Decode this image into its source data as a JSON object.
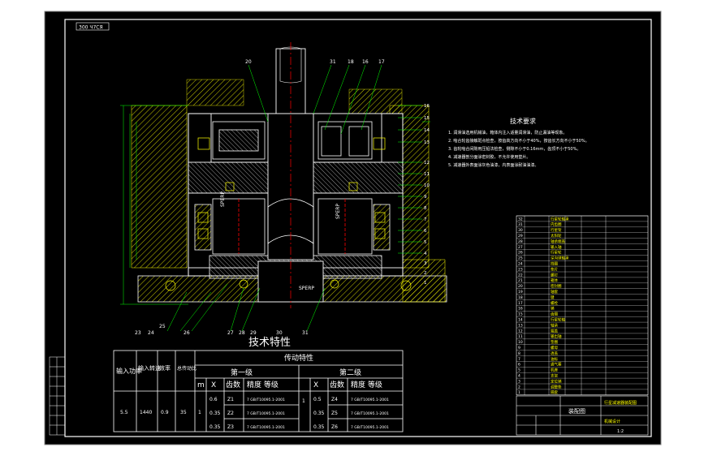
{
  "drawing": {
    "view_label": "300 Ч7СЯ",
    "tech_req_title": "技术要求",
    "tech_req": [
      "1. 润滑油选用机械油，箱体内注入适量润滑油，防止漏油等现象。",
      "2. 啮合轮齿接触斑点检查，按齿高方向不小于40%，按齿长方向不小于50%。",
      "3. 齿轮啮合间隙用压铅法检查，侧隙不小于0.16mm，齿顶不小于50%。",
      "4. 减速器剖分面涂密封胶，不允许使用垫片。",
      "5. 减速器外表面涂灰色油漆，内表面涂耐油油漆。"
    ],
    "callouts_top": [
      "20",
      "31",
      "18",
      "16",
      "17"
    ],
    "callouts_right": [
      "16",
      "15",
      "14",
      "13",
      "12",
      "11",
      "10",
      "9",
      "8",
      "7",
      "6",
      "5",
      "4",
      "3",
      "2",
      "1"
    ],
    "callouts_bottom": [
      "23",
      "24",
      "25",
      "26",
      "27",
      "28",
      "29",
      "30",
      "31"
    ],
    "shaft_labels": [
      "SPERP",
      "SPERP",
      "SPERP"
    ],
    "title_block": {
      "name": "行星减速器装配图",
      "school": "机械设计",
      "scale": "1:2"
    }
  },
  "spec_table": {
    "title": "技术特性",
    "headers": {
      "input_power": "输入功率",
      "input_speed": "输入转速",
      "efficiency": "效率",
      "total_ratio": "总传动比",
      "transmission": "传动特性",
      "stage1": "第一级",
      "stage2": "第二级",
      "m": "m",
      "x": "X",
      "teeth": "齿数",
      "grade": "精度 等级"
    },
    "values": {
      "power": "5.5",
      "speed": "1440",
      "efficiency": "0.9",
      "ratio": "35",
      "m1": "1",
      "m2": "1"
    },
    "rows1": [
      {
        "x": "0.6",
        "z": "Z1",
        "grade": "7 GB/T10095.1-2001"
      },
      {
        "x": "0.35",
        "z": "Z2",
        "grade": "7 GB/T10095.1-2001"
      },
      {
        "x": "0.35",
        "z": "Z3",
        "grade": "7 GB/T10095.1-2001"
      }
    ],
    "rows2": [
      {
        "x": "0.5",
        "z": "Z4",
        "grade": "7 GB/T10095.1-2001"
      },
      {
        "x": "0.35",
        "z": "Z5",
        "grade": "7 GB/T10095.1-2001"
      },
      {
        "x": "0.35",
        "z": "Z6",
        "grade": "7 GB/T10095.1-2001"
      }
    ]
  },
  "bom": {
    "rows": [
      "行星轮轴承",
      "内齿圈",
      "行星架",
      "太阳轮",
      "轴承端盖",
      "输入轴",
      "行星轮",
      "深沟球轴承",
      "挡圈",
      "垫片",
      "螺钉",
      "箱体",
      "密封圈",
      "轴套",
      "键",
      "螺栓",
      "销",
      "齿圈",
      "行星轮轴",
      "轴承",
      "端盖",
      "输出轴",
      "垫圈",
      "螺母",
      "透盖",
      "油标",
      "通气塞",
      "机座",
      "支架",
      "定位销",
      "调整垫",
      "隔套"
    ],
    "footer": "装配图"
  },
  "colors": {
    "bg": "#000000",
    "paper_bg": "#ffffff",
    "frame": "#ffffff",
    "yellow": "#ffff00",
    "green": "#00ff00",
    "cyan": "#00ffff",
    "red": "#ff0000",
    "hatch": "#ffff00"
  }
}
